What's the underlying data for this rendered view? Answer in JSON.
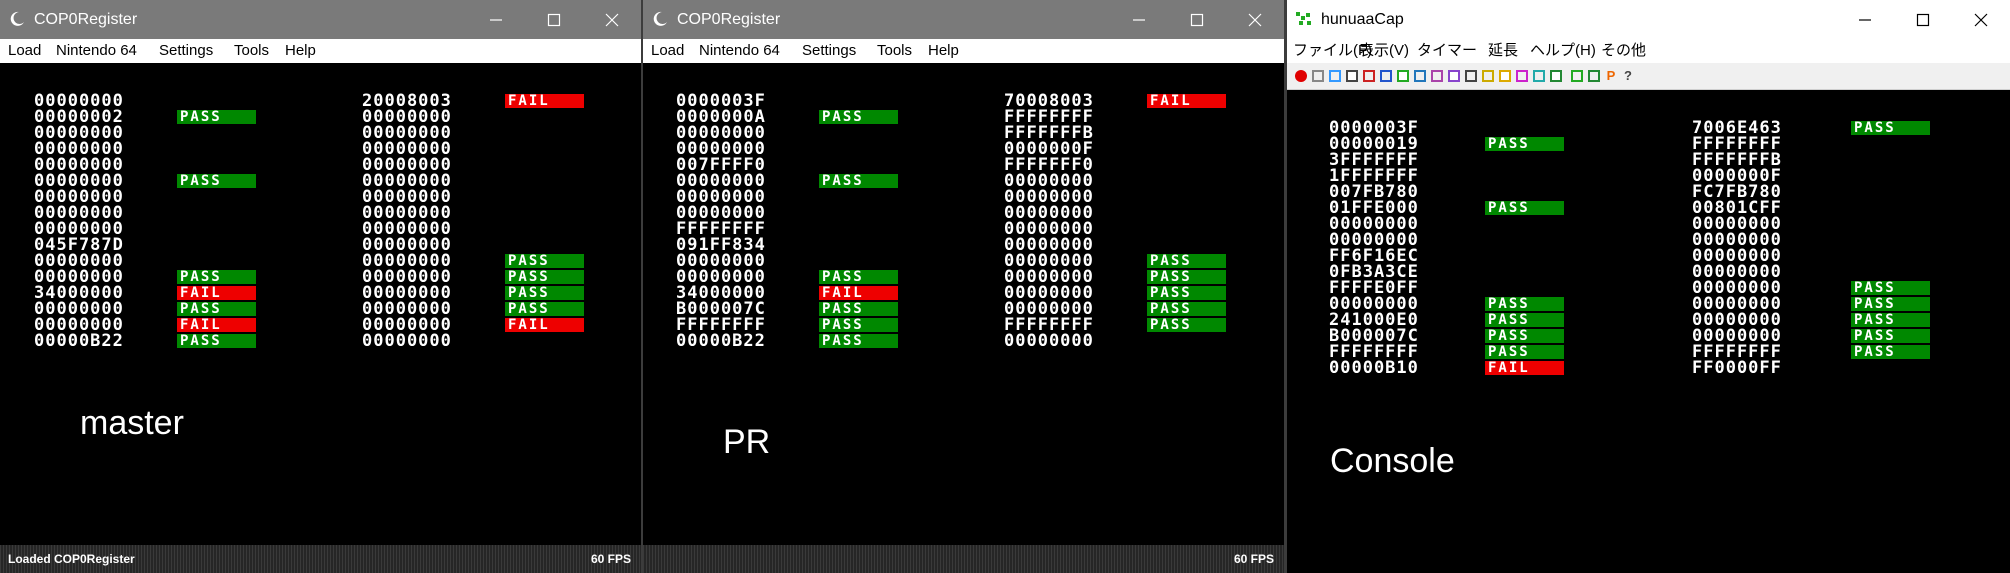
{
  "colors": {
    "pass": "#008800",
    "fail": "#ee0000",
    "text": "#ffffff",
    "screen": "#000000"
  },
  "master": {
    "title": "COP0Register",
    "menu": [
      "Load",
      "Nintendo 64",
      "Settings",
      "Tools",
      "Help"
    ],
    "status": "Loaded COP0Register",
    "fps": "60 FPS",
    "caption": "master",
    "left_rows": [
      {
        "hex": "00000000",
        "result": ""
      },
      {
        "hex": "00000002",
        "result": "PASS"
      },
      {
        "hex": "00000000",
        "result": ""
      },
      {
        "hex": "00000000",
        "result": ""
      },
      {
        "hex": "00000000",
        "result": ""
      },
      {
        "hex": "00000000",
        "result": "PASS"
      },
      {
        "hex": "00000000",
        "result": ""
      },
      {
        "hex": "00000000",
        "result": ""
      },
      {
        "hex": "00000000",
        "result": ""
      },
      {
        "hex": "045F787D",
        "result": ""
      },
      {
        "hex": "00000000",
        "result": ""
      },
      {
        "hex": "00000000",
        "result": "PASS"
      },
      {
        "hex": "34000000",
        "result": "FAIL"
      },
      {
        "hex": "00000000",
        "result": "PASS"
      },
      {
        "hex": "00000000",
        "result": "FAIL"
      },
      {
        "hex": "00000B22",
        "result": "PASS"
      }
    ],
    "right_rows": [
      {
        "hex": "20008003",
        "result": "FAIL"
      },
      {
        "hex": "00000000",
        "result": ""
      },
      {
        "hex": "00000000",
        "result": ""
      },
      {
        "hex": "00000000",
        "result": ""
      },
      {
        "hex": "00000000",
        "result": ""
      },
      {
        "hex": "00000000",
        "result": ""
      },
      {
        "hex": "00000000",
        "result": ""
      },
      {
        "hex": "00000000",
        "result": ""
      },
      {
        "hex": "00000000",
        "result": ""
      },
      {
        "hex": "00000000",
        "result": ""
      },
      {
        "hex": "00000000",
        "result": "PASS"
      },
      {
        "hex": "00000000",
        "result": "PASS"
      },
      {
        "hex": "00000000",
        "result": "PASS"
      },
      {
        "hex": "00000000",
        "result": "PASS"
      },
      {
        "hex": "00000000",
        "result": "FAIL"
      },
      {
        "hex": "00000000",
        "result": ""
      }
    ]
  },
  "pr": {
    "title": "COP0Register",
    "menu": [
      "Load",
      "Nintendo 64",
      "Settings",
      "Tools",
      "Help"
    ],
    "status": "",
    "fps": "60 FPS",
    "caption": "PR",
    "left_rows": [
      {
        "hex": "0000003F",
        "result": ""
      },
      {
        "hex": "0000000A",
        "result": "PASS"
      },
      {
        "hex": "00000000",
        "result": ""
      },
      {
        "hex": "00000000",
        "result": ""
      },
      {
        "hex": "007FFFF0",
        "result": ""
      },
      {
        "hex": "00000000",
        "result": "PASS"
      },
      {
        "hex": "00000000",
        "result": ""
      },
      {
        "hex": "00000000",
        "result": ""
      },
      {
        "hex": "FFFFFFFF",
        "result": ""
      },
      {
        "hex": "091FF834",
        "result": ""
      },
      {
        "hex": "00000000",
        "result": ""
      },
      {
        "hex": "00000000",
        "result": "PASS"
      },
      {
        "hex": "34000000",
        "result": "FAIL"
      },
      {
        "hex": "B000007C",
        "result": "PASS"
      },
      {
        "hex": "FFFFFFFF",
        "result": "PASS"
      },
      {
        "hex": "00000B22",
        "result": "PASS"
      }
    ],
    "right_rows": [
      {
        "hex": "70008003",
        "result": "FAIL"
      },
      {
        "hex": "FFFFFFFF",
        "result": ""
      },
      {
        "hex": "FFFFFFFB",
        "result": ""
      },
      {
        "hex": "0000000F",
        "result": ""
      },
      {
        "hex": "FFFFFFF0",
        "result": ""
      },
      {
        "hex": "00000000",
        "result": ""
      },
      {
        "hex": "00000000",
        "result": ""
      },
      {
        "hex": "00000000",
        "result": ""
      },
      {
        "hex": "00000000",
        "result": ""
      },
      {
        "hex": "00000000",
        "result": ""
      },
      {
        "hex": "00000000",
        "result": "PASS"
      },
      {
        "hex": "00000000",
        "result": "PASS"
      },
      {
        "hex": "00000000",
        "result": "PASS"
      },
      {
        "hex": "00000000",
        "result": "PASS"
      },
      {
        "hex": "FFFFFFFF",
        "result": "PASS"
      },
      {
        "hex": "00000000",
        "result": ""
      }
    ]
  },
  "console": {
    "title": "hunuaaCap",
    "menu": [
      "ファイル(F)",
      "表示(V)",
      "タイマー",
      "延長",
      "ヘルプ(H)",
      "その他"
    ],
    "caption": "Console",
    "toolbar_icons": [
      "record-icon",
      "stop-icon",
      "window-icon",
      "print-icon",
      "save-icon",
      "image-icon",
      "config-icon",
      "graph-icon",
      "tool-icon",
      "pen-icon",
      "crop-icon",
      "resize-icon",
      "star-icon",
      "palette-icon",
      "link-icon",
      "tree-icon",
      "power-icon",
      "fan-icon",
      "p-icon",
      "help-icon"
    ],
    "toolbar_glyphs": {
      "p-icon": "P",
      "help-icon": "?"
    },
    "left_rows": [
      {
        "hex": "0000003F",
        "result": ""
      },
      {
        "hex": "00000019",
        "result": "PASS"
      },
      {
        "hex": "3FFFFFFF",
        "result": ""
      },
      {
        "hex": "1FFFFFFF",
        "result": ""
      },
      {
        "hex": "007FB780",
        "result": ""
      },
      {
        "hex": "01FFE000",
        "result": "PASS"
      },
      {
        "hex": "00000000",
        "result": ""
      },
      {
        "hex": "00000000",
        "result": ""
      },
      {
        "hex": "FF6F16EC",
        "result": ""
      },
      {
        "hex": "0FB3A3CE",
        "result": ""
      },
      {
        "hex": "FFFFE0FF",
        "result": ""
      },
      {
        "hex": "00000000",
        "result": "PASS"
      },
      {
        "hex": "241000E0",
        "result": "PASS"
      },
      {
        "hex": "B000007C",
        "result": "PASS"
      },
      {
        "hex": "FFFFFFFF",
        "result": "PASS"
      },
      {
        "hex": "00000B10",
        "result": "FAIL"
      }
    ],
    "right_rows": [
      {
        "hex": "7006E463",
        "result": "PASS"
      },
      {
        "hex": "FFFFFFFF",
        "result": ""
      },
      {
        "hex": "FFFFFFFB",
        "result": ""
      },
      {
        "hex": "0000000F",
        "result": ""
      },
      {
        "hex": "FC7FB780",
        "result": ""
      },
      {
        "hex": "00801CFF",
        "result": ""
      },
      {
        "hex": "00000000",
        "result": ""
      },
      {
        "hex": "00000000",
        "result": ""
      },
      {
        "hex": "00000000",
        "result": ""
      },
      {
        "hex": "00000000",
        "result": ""
      },
      {
        "hex": "00000000",
        "result": "PASS"
      },
      {
        "hex": "00000000",
        "result": "PASS"
      },
      {
        "hex": "00000000",
        "result": "PASS"
      },
      {
        "hex": "00000000",
        "result": "PASS"
      },
      {
        "hex": "FFFFFFFF",
        "result": "PASS"
      },
      {
        "hex": "FF0000FF",
        "result": ""
      }
    ]
  }
}
